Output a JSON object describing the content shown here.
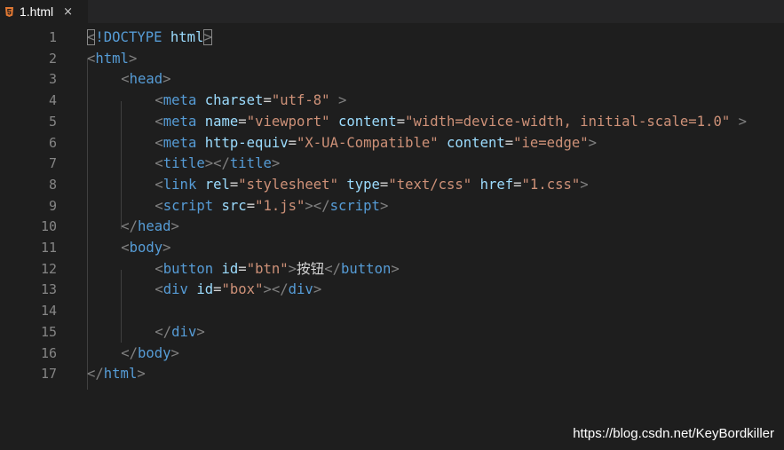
{
  "tab": {
    "icon": "html5-icon",
    "title": "1.html",
    "close_glyph": "×"
  },
  "editor": {
    "lines": [
      {
        "num": "1",
        "indent": 0,
        "tokens": [
          {
            "t": "<",
            "c": "brhl"
          },
          {
            "t": "!DOCTYPE",
            "c": "kw"
          },
          {
            "t": " html",
            "c": "attr"
          },
          {
            "t": ">",
            "c": "brhl"
          }
        ]
      },
      {
        "num": "2",
        "indent": 0,
        "tokens": [
          {
            "t": "<",
            "c": "br"
          },
          {
            "t": "html",
            "c": "tag"
          },
          {
            "t": ">",
            "c": "br"
          }
        ]
      },
      {
        "num": "3",
        "indent": 4,
        "tokens": [
          {
            "t": "<",
            "c": "br"
          },
          {
            "t": "head",
            "c": "tag"
          },
          {
            "t": ">",
            "c": "br"
          }
        ]
      },
      {
        "num": "4",
        "indent": 8,
        "tokens": [
          {
            "t": "<",
            "c": "br"
          },
          {
            "t": "meta",
            "c": "tag"
          },
          {
            "t": " charset",
            "c": "attr"
          },
          {
            "t": "=",
            "c": "txt"
          },
          {
            "t": "\"utf-8\"",
            "c": "str"
          },
          {
            "t": " >",
            "c": "br"
          }
        ]
      },
      {
        "num": "5",
        "indent": 8,
        "tokens": [
          {
            "t": "<",
            "c": "br"
          },
          {
            "t": "meta",
            "c": "tag"
          },
          {
            "t": " name",
            "c": "attr"
          },
          {
            "t": "=",
            "c": "txt"
          },
          {
            "t": "\"viewport\"",
            "c": "str"
          },
          {
            "t": " content",
            "c": "attr"
          },
          {
            "t": "=",
            "c": "txt"
          },
          {
            "t": "\"width=device-width, initial-scale=1.0\"",
            "c": "str"
          },
          {
            "t": " >",
            "c": "br"
          }
        ]
      },
      {
        "num": "6",
        "indent": 8,
        "tokens": [
          {
            "t": "<",
            "c": "br"
          },
          {
            "t": "meta",
            "c": "tag"
          },
          {
            "t": " http-equiv",
            "c": "attr"
          },
          {
            "t": "=",
            "c": "txt"
          },
          {
            "t": "\"X-UA-Compatible\"",
            "c": "str"
          },
          {
            "t": " content",
            "c": "attr"
          },
          {
            "t": "=",
            "c": "txt"
          },
          {
            "t": "\"ie=edge\"",
            "c": "str"
          },
          {
            "t": ">",
            "c": "br"
          }
        ]
      },
      {
        "num": "7",
        "indent": 8,
        "tokens": [
          {
            "t": "<",
            "c": "br"
          },
          {
            "t": "title",
            "c": "tag"
          },
          {
            "t": "></",
            "c": "br"
          },
          {
            "t": "title",
            "c": "tag"
          },
          {
            "t": ">",
            "c": "br"
          }
        ]
      },
      {
        "num": "8",
        "indent": 8,
        "tokens": [
          {
            "t": "<",
            "c": "br"
          },
          {
            "t": "link",
            "c": "tag"
          },
          {
            "t": " rel",
            "c": "attr"
          },
          {
            "t": "=",
            "c": "txt"
          },
          {
            "t": "\"stylesheet\"",
            "c": "str"
          },
          {
            "t": " type",
            "c": "attr"
          },
          {
            "t": "=",
            "c": "txt"
          },
          {
            "t": "\"text/css\"",
            "c": "str"
          },
          {
            "t": " href",
            "c": "attr"
          },
          {
            "t": "=",
            "c": "txt"
          },
          {
            "t": "\"1.css\"",
            "c": "str"
          },
          {
            "t": ">",
            "c": "br"
          }
        ]
      },
      {
        "num": "9",
        "indent": 8,
        "tokens": [
          {
            "t": "<",
            "c": "br"
          },
          {
            "t": "script",
            "c": "tag"
          },
          {
            "t": " src",
            "c": "attr"
          },
          {
            "t": "=",
            "c": "txt"
          },
          {
            "t": "\"1.js\"",
            "c": "str"
          },
          {
            "t": "></",
            "c": "br"
          },
          {
            "t": "script",
            "c": "tag"
          },
          {
            "t": ">",
            "c": "br"
          }
        ]
      },
      {
        "num": "10",
        "indent": 4,
        "tokens": [
          {
            "t": "</",
            "c": "br"
          },
          {
            "t": "head",
            "c": "tag"
          },
          {
            "t": ">",
            "c": "br"
          }
        ]
      },
      {
        "num": "11",
        "indent": 4,
        "tokens": [
          {
            "t": "<",
            "c": "br"
          },
          {
            "t": "body",
            "c": "tag"
          },
          {
            "t": ">",
            "c": "br"
          }
        ]
      },
      {
        "num": "12",
        "indent": 8,
        "tokens": [
          {
            "t": "<",
            "c": "br"
          },
          {
            "t": "button",
            "c": "tag"
          },
          {
            "t": " id",
            "c": "attr"
          },
          {
            "t": "=",
            "c": "txt"
          },
          {
            "t": "\"btn\"",
            "c": "str"
          },
          {
            "t": ">",
            "c": "br"
          },
          {
            "t": "按钮",
            "c": "cjk"
          },
          {
            "t": "</",
            "c": "br"
          },
          {
            "t": "button",
            "c": "tag"
          },
          {
            "t": ">",
            "c": "br"
          }
        ]
      },
      {
        "num": "13",
        "indent": 8,
        "tokens": [
          {
            "t": "<",
            "c": "br"
          },
          {
            "t": "div",
            "c": "tag"
          },
          {
            "t": " id",
            "c": "attr"
          },
          {
            "t": "=",
            "c": "txt"
          },
          {
            "t": "\"box\"",
            "c": "str"
          },
          {
            "t": "></",
            "c": "br"
          },
          {
            "t": "div",
            "c": "tag"
          },
          {
            "t": ">",
            "c": "br"
          }
        ]
      },
      {
        "num": "14",
        "indent": 0,
        "tokens": []
      },
      {
        "num": "15",
        "indent": 8,
        "tokens": [
          {
            "t": "</",
            "c": "br"
          },
          {
            "t": "div",
            "c": "tag"
          },
          {
            "t": ">",
            "c": "br"
          }
        ]
      },
      {
        "num": "16",
        "indent": 4,
        "tokens": [
          {
            "t": "</",
            "c": "br"
          },
          {
            "t": "body",
            "c": "tag"
          },
          {
            "t": ">",
            "c": "br"
          }
        ]
      },
      {
        "num": "17",
        "indent": 0,
        "tokens": [
          {
            "t": "</",
            "c": "br"
          },
          {
            "t": "html",
            "c": "tag"
          },
          {
            "t": ">",
            "c": "br"
          }
        ]
      }
    ]
  },
  "watermark": "https://blog.csdn.net/KeyBordkiller",
  "colors": {
    "background": "#1e1e1e",
    "tabbar": "#252526",
    "tag": "#569cd6",
    "attribute": "#9cdcfe",
    "string": "#ce9178",
    "bracket": "#808080",
    "line_number": "#858585",
    "html5_icon": "#e37933"
  }
}
